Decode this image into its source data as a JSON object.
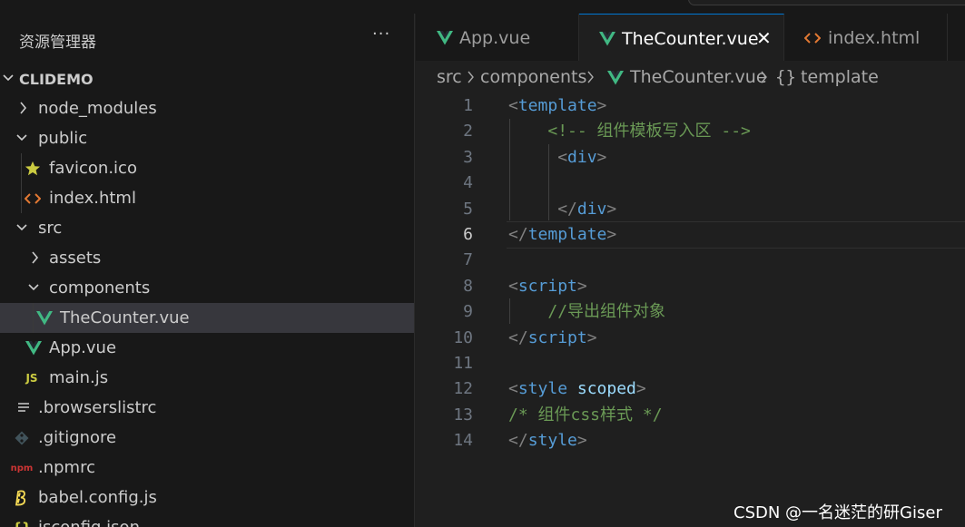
{
  "sidebar": {
    "title": "资源管理器",
    "more_label": "···",
    "root": "CLIDEMO",
    "items": [
      {
        "label": "node_modules",
        "icon": "chevron-right-icon"
      },
      {
        "label": "public",
        "icon": "chevron-down-icon"
      },
      {
        "label": "favicon.ico",
        "icon": "star-icon"
      },
      {
        "label": "index.html",
        "icon": "html-icon"
      },
      {
        "label": "src",
        "icon": "chevron-down-icon"
      },
      {
        "label": "assets",
        "icon": "chevron-right-icon"
      },
      {
        "label": "components",
        "icon": "chevron-down-icon"
      },
      {
        "label": "TheCounter.vue",
        "icon": "vue-icon",
        "selected": true
      },
      {
        "label": "App.vue",
        "icon": "vue-icon"
      },
      {
        "label": "main.js",
        "icon": "js-icon"
      },
      {
        "label": ".browserslistrc",
        "icon": "lines-icon"
      },
      {
        "label": ".gitignore",
        "icon": "git-icon"
      },
      {
        "label": ".npmrc",
        "icon": "npm-icon"
      },
      {
        "label": "babel.config.js",
        "icon": "babel-icon"
      },
      {
        "label": "jsconfig.json",
        "icon": "json-icon"
      }
    ],
    "icon_text": {
      "js": "JS",
      "npm": "npm",
      "json": "{}"
    }
  },
  "tabs": [
    {
      "label": "App.vue",
      "icon": "vue-icon"
    },
    {
      "label": "TheCounter.vue",
      "icon": "vue-icon",
      "active": true,
      "close": "✕"
    },
    {
      "label": "index.html",
      "icon": "html-icon"
    }
  ],
  "breadcrumb": {
    "parts": [
      "src",
      "components",
      "TheCounter.vue",
      "template"
    ],
    "template_icon": "{}"
  },
  "editor": {
    "current_line": 6,
    "lines": [
      {
        "n": "1",
        "parts": [
          [
            "tagp",
            "<"
          ],
          [
            "tagn",
            "template"
          ],
          [
            "tagp",
            ">"
          ]
        ]
      },
      {
        "n": "2",
        "parts": [
          [
            "sp",
            "    "
          ],
          [
            "cmt",
            "<!-- 组件模板写入区 -->"
          ]
        ]
      },
      {
        "n": "3",
        "parts": [
          [
            "sp",
            "     "
          ],
          [
            "tagp",
            "<"
          ],
          [
            "tagn",
            "div"
          ],
          [
            "tagp",
            ">"
          ]
        ]
      },
      {
        "n": "4",
        "parts": []
      },
      {
        "n": "5",
        "parts": [
          [
            "sp",
            "     "
          ],
          [
            "tagp",
            "</"
          ],
          [
            "tagn",
            "div"
          ],
          [
            "tagp",
            ">"
          ]
        ]
      },
      {
        "n": "6",
        "parts": [
          [
            "tagp",
            "</"
          ],
          [
            "tagn",
            "template"
          ],
          [
            "tagp",
            ">"
          ]
        ]
      },
      {
        "n": "7",
        "parts": []
      },
      {
        "n": "8",
        "parts": [
          [
            "tagp",
            "<"
          ],
          [
            "tagn",
            "script"
          ],
          [
            "tagp",
            ">"
          ]
        ]
      },
      {
        "n": "9",
        "parts": [
          [
            "sp",
            "    "
          ],
          [
            "cmt",
            "//导出组件对象"
          ]
        ]
      },
      {
        "n": "10",
        "parts": [
          [
            "tagp",
            "</"
          ],
          [
            "tagn",
            "script"
          ],
          [
            "tagp",
            ">"
          ]
        ]
      },
      {
        "n": "11",
        "parts": []
      },
      {
        "n": "12",
        "parts": [
          [
            "tagp",
            "<"
          ],
          [
            "tagn",
            "style"
          ],
          [
            "sp",
            " "
          ],
          [
            "attr",
            "scoped"
          ],
          [
            "tagp",
            ">"
          ]
        ]
      },
      {
        "n": "13",
        "parts": [
          [
            "cmt",
            "/* 组件css样式 */"
          ]
        ]
      },
      {
        "n": "14",
        "parts": [
          [
            "tagp",
            "</"
          ],
          [
            "tagn",
            "style"
          ],
          [
            "tagp",
            ">"
          ]
        ]
      }
    ]
  },
  "watermark": "CSDN @一名迷茫的研Giser",
  "colors": {
    "vue_green": "#41b883",
    "html_orange": "#e37933",
    "js_yellow": "#cbcb41",
    "accent": "#0078d4",
    "tag_blue": "#569cd6",
    "comment_green": "#6a9955",
    "attr_lightblue": "#9cdcfe"
  }
}
